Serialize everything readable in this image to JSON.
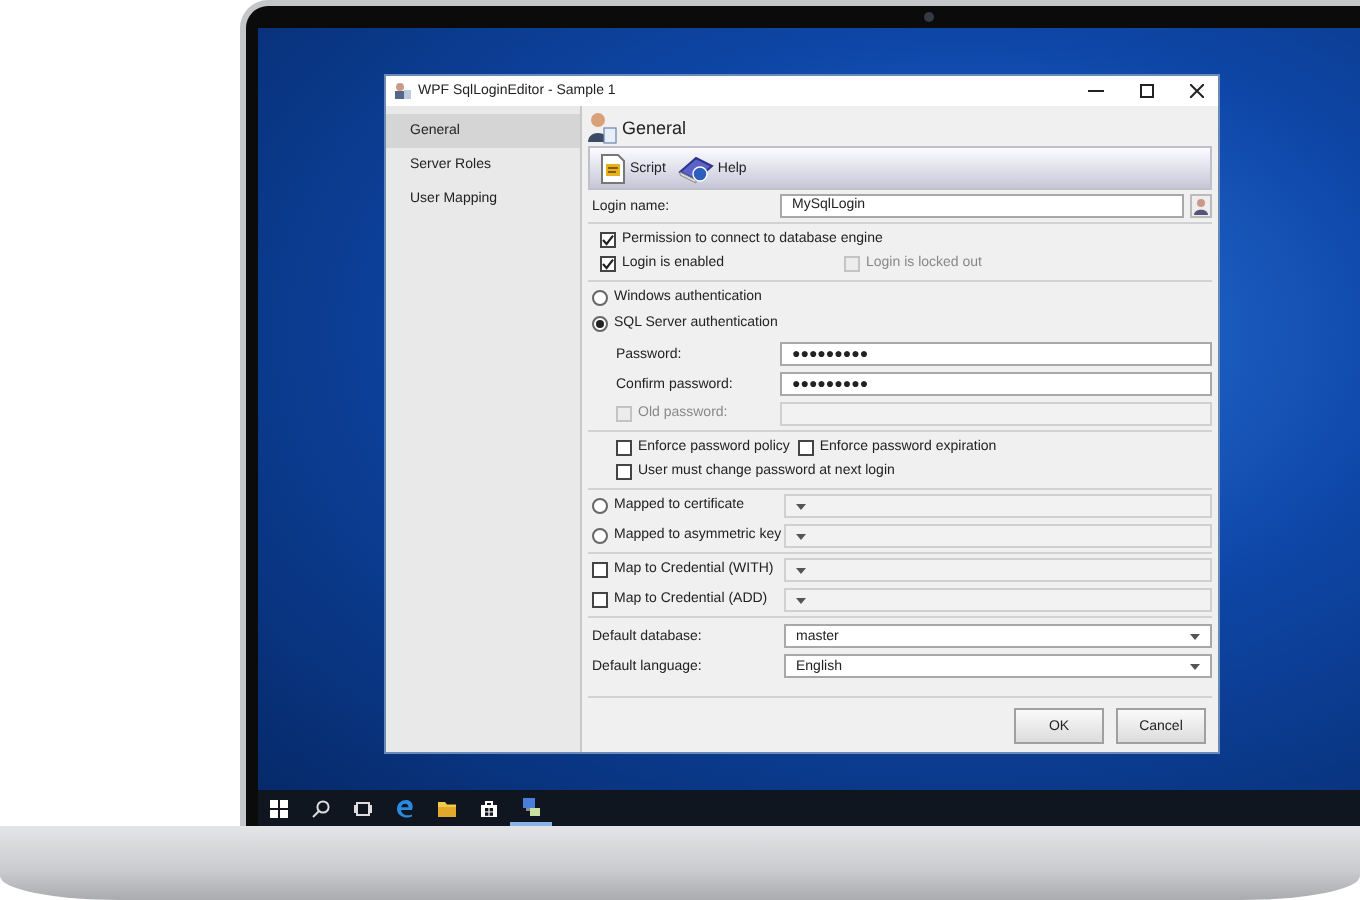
{
  "window": {
    "title": "WPF SqlLoginEditor - Sample 1"
  },
  "sidebar": {
    "items": [
      {
        "label": "General",
        "selected": true
      },
      {
        "label": "Server Roles",
        "selected": false
      },
      {
        "label": "User Mapping",
        "selected": false
      }
    ]
  },
  "header": {
    "title": "General"
  },
  "toolbar": {
    "buttons": [
      {
        "label": "Script",
        "kind": "script"
      },
      {
        "label": "Help",
        "kind": "help"
      }
    ]
  },
  "login_name": {
    "label": "Login name:",
    "value": "MySqlLogin"
  },
  "login_options": [
    {
      "items": [
        {
          "label": "Permission to connect to database engine",
          "checked": true,
          "disabled": false
        }
      ]
    },
    {
      "items": [
        {
          "label": "Login is enabled",
          "checked": true,
          "disabled": false
        },
        {
          "label": "Login is locked out",
          "checked": false,
          "disabled": true
        }
      ]
    }
  ],
  "authentication": [
    {
      "label": "Windows authentication",
      "selected": false
    },
    {
      "label": "SQL Server authentication",
      "selected": true
    }
  ],
  "password_fields": [
    {
      "kind": "plain",
      "label": "Password:",
      "value": "●●●●●●●●●",
      "disabled": false
    },
    {
      "kind": "plain",
      "label": "Confirm password:",
      "value": "●●●●●●●●●",
      "disabled": false
    },
    {
      "kind": "checkbox",
      "label": "Old password:",
      "checked": false,
      "disabled": true
    }
  ],
  "policy_options": [
    {
      "items": [
        {
          "label": "Enforce password policy",
          "checked": false,
          "disabled": false
        },
        {
          "label": "Enforce password expiration",
          "checked": false,
          "disabled": false
        }
      ]
    },
    {
      "items": [
        {
          "label": "User must change password at next login",
          "checked": false,
          "disabled": false
        }
      ]
    }
  ],
  "mapping_groups": [
    {
      "rows": [
        {
          "kind": "radio",
          "label": "Mapped to certificate",
          "selected": false,
          "disabled": true
        },
        {
          "kind": "radio",
          "label": "Mapped to asymmetric key",
          "selected": false,
          "disabled": true
        }
      ]
    },
    {
      "rows": [
        {
          "kind": "checkbox",
          "label": "Map to Credential (WITH)",
          "checked": false,
          "disabled": true
        },
        {
          "kind": "checkbox",
          "label": "Map to Credential (ADD)",
          "checked": false,
          "disabled": true
        }
      ]
    }
  ],
  "defaults": [
    {
      "label": "Default database:",
      "value": "master"
    },
    {
      "label": "Default language:",
      "value": "English"
    }
  ],
  "buttons": [
    {
      "label": "OK"
    },
    {
      "label": "Cancel"
    }
  ]
}
